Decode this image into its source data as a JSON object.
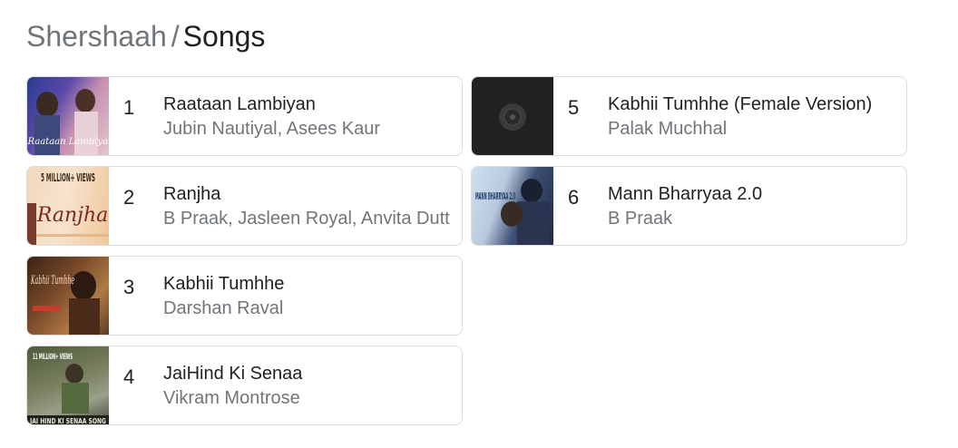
{
  "header": {
    "parent": "Shershaah",
    "separator": "/",
    "current": "Songs"
  },
  "songs": [
    {
      "rank": "1",
      "title": "Raataan Lambiyan",
      "artist": "Jubin Nautiyal, Asees Kaur",
      "thumb_text": "Raataan Lambiyan",
      "thumb_icon": "album-art-thumbnail"
    },
    {
      "rank": "2",
      "title": "Ranjha",
      "artist": "B Praak, Jasleen Royal, Anvita Dutt",
      "thumb_text": "Ranjha",
      "thumb_badge": "5 MILLION+ VIEWS",
      "thumb_icon": "album-art-thumbnail"
    },
    {
      "rank": "3",
      "title": "Kabhii Tumhhe",
      "artist": "Darshan Raval",
      "thumb_text": "Kabhii Tumhhe",
      "thumb_icon": "album-art-thumbnail"
    },
    {
      "rank": "4",
      "title": "JaiHind Ki Senaa",
      "artist": "Vikram Montrose",
      "thumb_text": "JAI HIND KI SENAA SONG",
      "thumb_badge": "11 MILLION+ VIEWS",
      "thumb_icon": "album-art-thumbnail"
    },
    {
      "rank": "5",
      "title": "Kabhii Tumhhe (Female Version)",
      "artist": "Palak Muchhal",
      "thumb_icon": "vinyl-record-icon"
    },
    {
      "rank": "6",
      "title": "Mann Bharryaa 2.0",
      "artist": "B Praak",
      "thumb_text": "MANN BHARRYAA 2.0",
      "thumb_icon": "album-art-thumbnail"
    }
  ],
  "colors": {
    "text_primary": "#202124",
    "text_secondary": "#70757a",
    "border": "#dadce0",
    "vinyl_bg": "#212121"
  }
}
